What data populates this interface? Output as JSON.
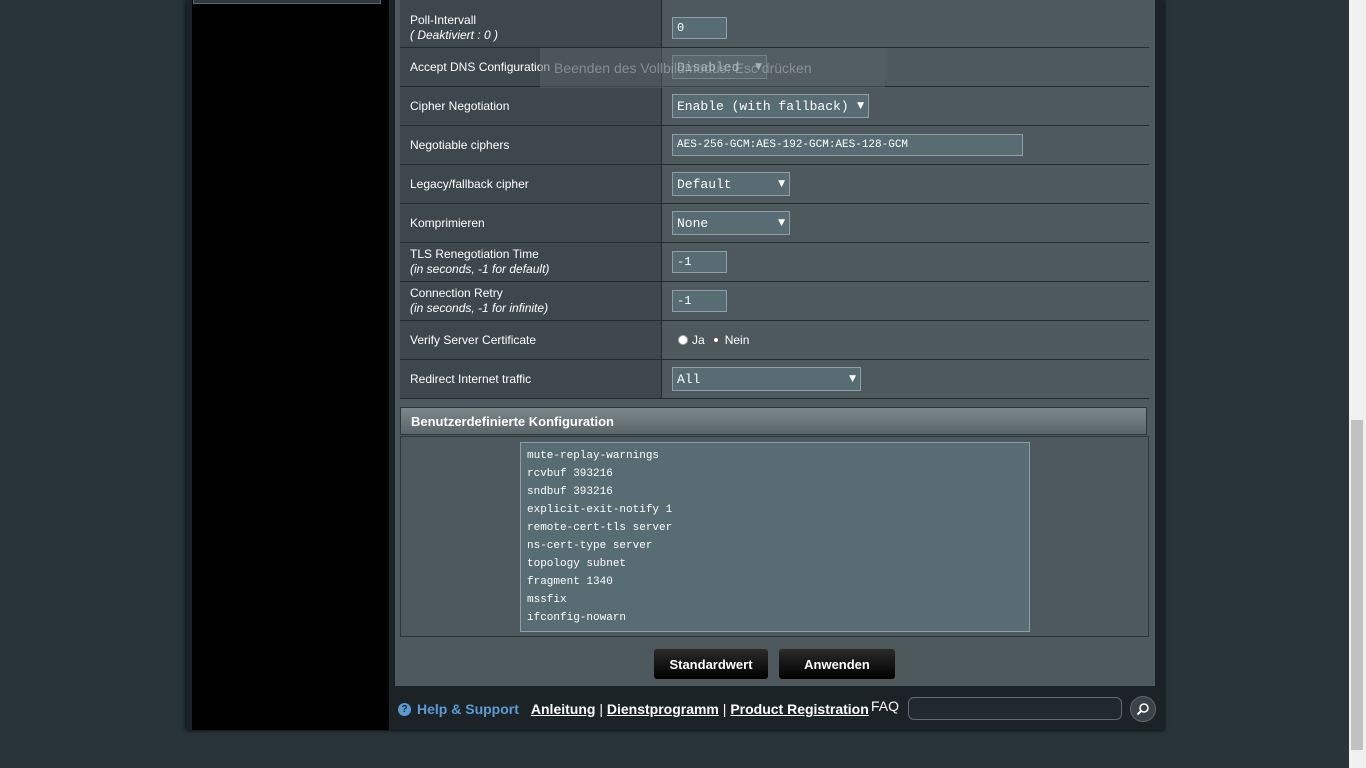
{
  "rows": {
    "poll": {
      "label": "Poll-Intervall",
      "sub": "( Deaktiviert : 0 )",
      "value": "0"
    },
    "dns": {
      "label": "Accept DNS Configuration",
      "value": "Disabled"
    },
    "cipher": {
      "label": "Cipher Negotiation",
      "value": "Enable (with fallback)"
    },
    "negotiable": {
      "label": "Negotiable ciphers",
      "value": "AES-256-GCM:AES-192-GCM:AES-128-GCM"
    },
    "legacy": {
      "label": "Legacy/fallback cipher",
      "value": "Default"
    },
    "compress": {
      "label": "Komprimieren",
      "value": "None"
    },
    "tls": {
      "label": "TLS Renegotiation Time",
      "sub": "(in seconds, -1 for default)",
      "value": "-1"
    },
    "retry": {
      "label": "Connection Retry",
      "sub": "(in seconds, -1 for infinite)",
      "value": "-1"
    },
    "verify": {
      "label": "Verify Server Certificate",
      "yes": "Ja",
      "no": "Nein",
      "selected": "Nein"
    },
    "redirect": {
      "label": "Redirect Internet traffic",
      "value": "All"
    }
  },
  "custom": {
    "title": "Benutzerdefinierte Konfiguration",
    "lines": [
      "mute-replay-warnings",
      "rcvbuf 393216",
      "sndbuf 393216",
      "explicit-exit-notify 1",
      "remote-cert-tls server",
      "ns-cert-type server",
      "topology subnet",
      "fragment 1340",
      "mssfix",
      "ifconfig-nowarn"
    ]
  },
  "buttons": {
    "default": "Standardwert",
    "apply": "Anwenden"
  },
  "overlay": {
    "text": "Beenden des Vollbildmodus: Esc drücken"
  },
  "footer": {
    "help": "Help & Support",
    "manual": "Anleitung",
    "utility": "Dienstprogramm",
    "registration": "Product Registration",
    "faq": "FAQ"
  },
  "icons": {
    "help": "question-circle-icon",
    "search": "magnifier-icon"
  },
  "colors": {
    "accent": "#5b9bd5",
    "panel": "#4d595d",
    "header": "#6f7b7f"
  }
}
